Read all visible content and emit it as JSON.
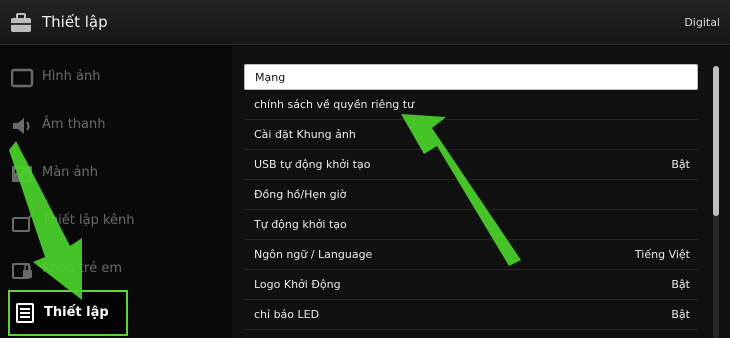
{
  "header": {
    "title": "Thiết lập",
    "source": "Digital"
  },
  "sidebar": {
    "items": [
      {
        "label": "Hình ảnh",
        "icon": "picture-icon"
      },
      {
        "label": "Âm thanh",
        "icon": "speaker-icon"
      },
      {
        "label": "Màn ảnh",
        "icon": "screen-icon"
      },
      {
        "label": "Thiết lập kênh",
        "icon": "antenna-icon"
      },
      {
        "label": "Khóa trẻ em",
        "icon": "lock-icon"
      },
      {
        "label": "Thiết lập",
        "icon": "briefcase-icon",
        "selected": true
      }
    ]
  },
  "menu": {
    "items": [
      {
        "label": "Mạng",
        "value": ""
      },
      {
        "label": "chính sách về quyền riêng tư",
        "value": ""
      },
      {
        "label": "Cài đặt Khung ảnh",
        "value": ""
      },
      {
        "label": "USB tự động khởi tạo",
        "value": "Bật"
      },
      {
        "label": "Đồng hồ/Hẹn giờ",
        "value": ""
      },
      {
        "label": "Tự động khởi tạo",
        "value": ""
      },
      {
        "label": "Ngôn ngữ / Language",
        "value": "Tiếng Việt"
      },
      {
        "label": "Logo Khởi Động",
        "value": "Bật"
      },
      {
        "label": "chỉ báo LED",
        "value": "Bật"
      }
    ],
    "focused_index": 0
  },
  "colors": {
    "highlight": "#5fd337",
    "arrow": "#4ad22b"
  }
}
